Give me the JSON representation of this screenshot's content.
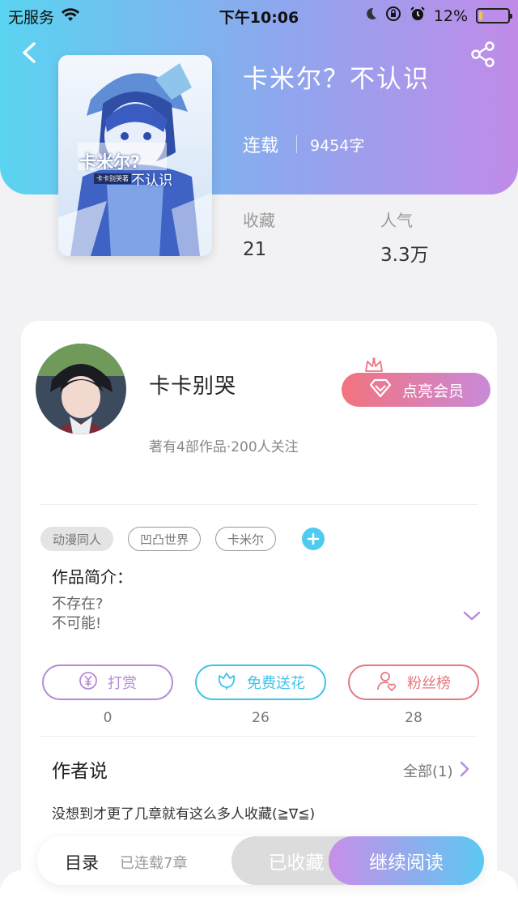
{
  "status_bar": {
    "carrier": "无服务",
    "time": "下午10:06",
    "battery_text": "12%",
    "battery_level": 0.12
  },
  "book": {
    "title": "卡米尔？不认识",
    "status": "连载",
    "word_count": "9454字",
    "cover_title": "卡米尔?",
    "cover_subtitle": "不认识",
    "cover_badge": "卡卡别哭著",
    "stats": [
      {
        "label": "收藏",
        "value": "21"
      },
      {
        "label": "人气",
        "value": "3.3万"
      }
    ]
  },
  "author": {
    "name": "卡卡别哭",
    "info": "著有4部作品·200人关注",
    "vip_label": "点亮会员"
  },
  "tags": [
    "动漫同人",
    "凹凸世界",
    "卡米尔"
  ],
  "intro": {
    "title": "作品简介：",
    "lines": [
      "不存在?",
      "不可能!"
    ]
  },
  "actions": [
    {
      "label": "打赏",
      "count": "0",
      "icon": "yen-coin-icon",
      "color": "#b48ad8"
    },
    {
      "label": "免费送花",
      "count": "26",
      "icon": "flower-icon",
      "color": "#3ec3ea"
    },
    {
      "label": "粉丝榜",
      "count": "28",
      "icon": "fan-user-icon",
      "color": "#e7787e"
    }
  ],
  "author_says": {
    "title": "作者说",
    "all_label": "全部(1)",
    "text": "没想到才更了几章就有这么多人收藏(≧∇≦)"
  },
  "bottom_bar": {
    "toc": "目录",
    "chapters": "已连载7章",
    "favorited": "已收藏",
    "continue": "继续阅读"
  },
  "colors": {
    "header_start": "#5ad4f0",
    "header_end": "#c08be8",
    "accent_blue": "#4fcaf0",
    "accent_purple": "#b48ad8"
  }
}
